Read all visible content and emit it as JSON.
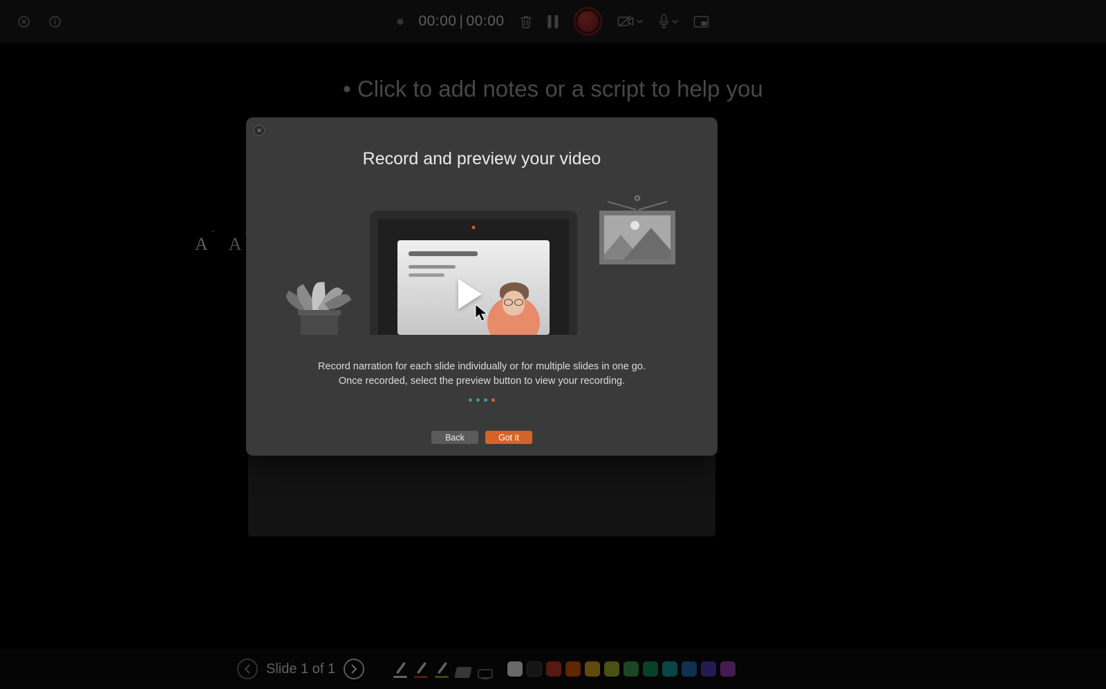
{
  "topbar": {
    "timer_current": "00:00",
    "timer_total": "00:00"
  },
  "notes": {
    "placeholder_line": "Click to add notes or a script to help you"
  },
  "fontControls": {
    "increase_glyph": "A",
    "decrease_glyph": "A"
  },
  "bottom": {
    "slide_label": "Slide 1 of 1",
    "pens": [
      {
        "name": "pen-white",
        "stroke": "#d9d9d9",
        "underline": "#d9d9d9"
      },
      {
        "name": "pen-red",
        "stroke": "#d9d9d9",
        "underline": "#c0392b"
      },
      {
        "name": "pen-green",
        "stroke": "#d9d9d9",
        "underline": "#7aa23a"
      }
    ],
    "swatches": [
      "#e8e8e8",
      "#2f2f2f",
      "#c0392b",
      "#d35400",
      "#d9a420",
      "#a9b42c",
      "#3f9a4e",
      "#168f5a",
      "#159a9a",
      "#1f6db3",
      "#4a3fb3",
      "#9a3fb3"
    ]
  },
  "modal": {
    "title": "Record and preview your video",
    "desc_line1": "Record narration for each slide individually or for multiple slides in one go.",
    "desc_line2": "Once recorded, select the preview button to view your recording.",
    "back_label": "Back",
    "primary_label": "Got it",
    "step_count": 4,
    "active_step_index": 3
  }
}
